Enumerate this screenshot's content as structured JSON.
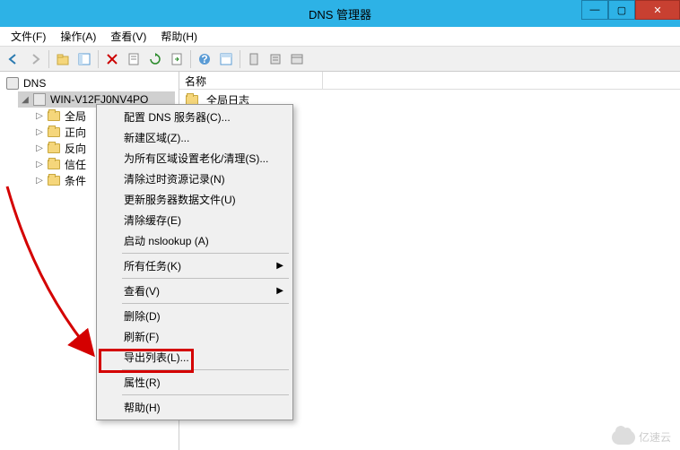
{
  "window": {
    "title": "DNS 管理器",
    "controls": {
      "minimize": "—",
      "maximize": "▢",
      "close": "✕"
    }
  },
  "menubar": {
    "file": "文件(F)",
    "action": "操作(A)",
    "view": "查看(V)",
    "help": "帮助(H)"
  },
  "tree": {
    "root": "DNS",
    "server": "WIN-V12FJ0NV4PO",
    "children": [
      "全局",
      "正向",
      "反向",
      "信任",
      "条件"
    ]
  },
  "list": {
    "column_name": "名称",
    "row0": "全局日志"
  },
  "context_menu": {
    "configure": "配置 DNS 服务器(C)...",
    "new_zone": "新建区域(Z)...",
    "set_aging": "为所有区域设置老化/清理(S)...",
    "scavenge": "清除过时资源记录(N)",
    "update_files": "更新服务器数据文件(U)",
    "clear_cache": "清除缓存(E)",
    "nslookup": "启动 nslookup (A)",
    "all_tasks": "所有任务(K)",
    "view": "查看(V)",
    "delete": "删除(D)",
    "refresh": "刷新(F)",
    "export_list": "导出列表(L)...",
    "properties": "属性(R)",
    "help": "帮助(H)"
  },
  "watermark": "亿速云"
}
